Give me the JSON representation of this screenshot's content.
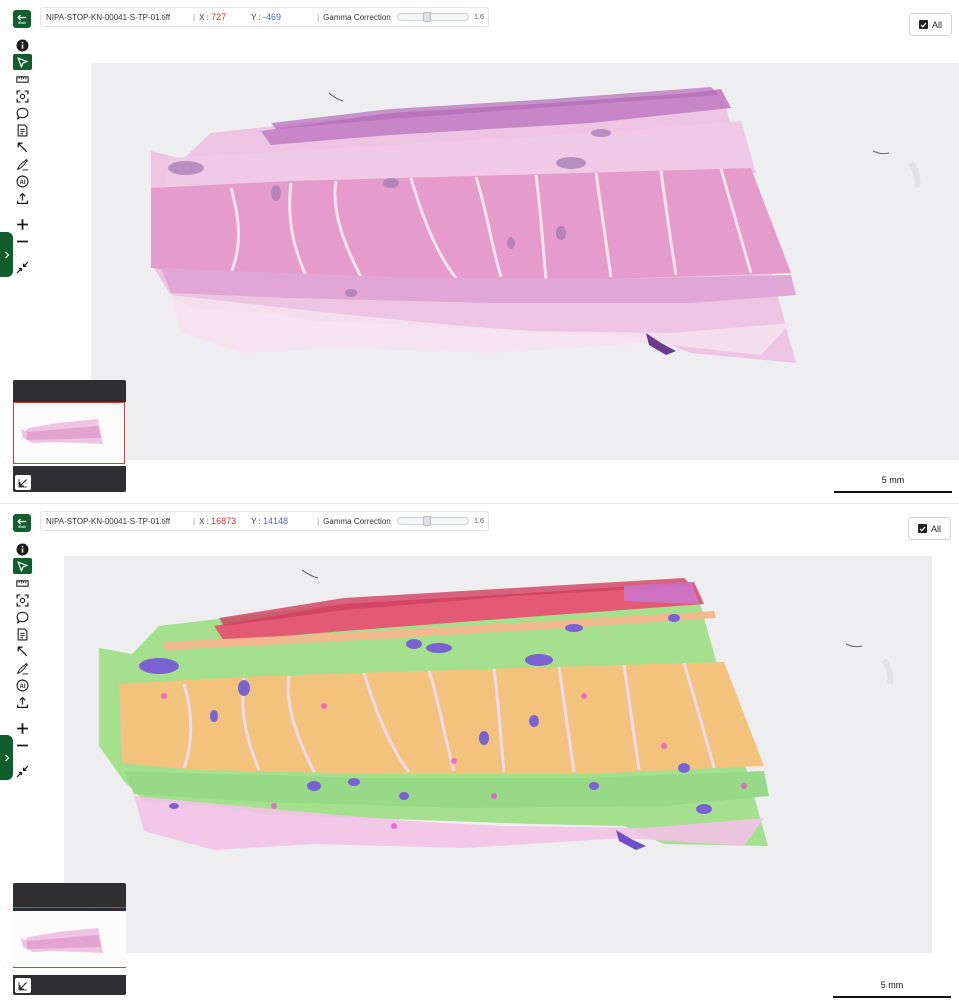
{
  "viewers": [
    {
      "id": "top",
      "infobar": {
        "file_name": "NIPA-STOP-KN-00041-S-TP-01.tiff",
        "x_label": "X :",
        "x_value": "727",
        "y_label": "Y :",
        "y_value": "-469",
        "gamma_label": "Gamma Correction",
        "gamma_value": "1.6"
      },
      "exit_label": "Exit",
      "all_button_label": "All",
      "all_checked": true,
      "scale_label": "5 mm",
      "image_mode": "H&E stain"
    },
    {
      "id": "bottom",
      "infobar": {
        "file_name": "NIPA-STOP-KN-00041-S-TP-01.tiff",
        "x_label": "X :",
        "x_value": "16873",
        "y_label": "Y :",
        "y_value": "14148",
        "gamma_label": "Gamma Correction",
        "gamma_value": "1.6"
      },
      "exit_label": "Exit",
      "all_button_label": "All",
      "all_checked": true,
      "scale_label": "5 mm",
      "image_mode": "segmentation overlay"
    }
  ],
  "toolbar_icons": [
    "info-icon",
    "select-pointer-icon",
    "ruler-icon",
    "roi-capture-icon",
    "comment-icon",
    "notes-icon",
    "arrow-annotate-icon",
    "brush-icon",
    "ai-icon",
    "upload-icon",
    "zoom-in-icon",
    "zoom-out-icon",
    "fit-screen-icon"
  ],
  "colors": {
    "brand_green": "#0f5e2c",
    "x_value": "#d0313d",
    "y_value": "#4e67c4",
    "he_pink": "#e7a3cf",
    "he_muscle": "#e28fbd",
    "he_nucleus": "#a874b0",
    "seg_green": "#9be28a",
    "seg_orange": "#f2bd7a",
    "seg_purple": "#7d63cf",
    "seg_red": "#e0506b"
  },
  "gamma_fraction": 0.4
}
